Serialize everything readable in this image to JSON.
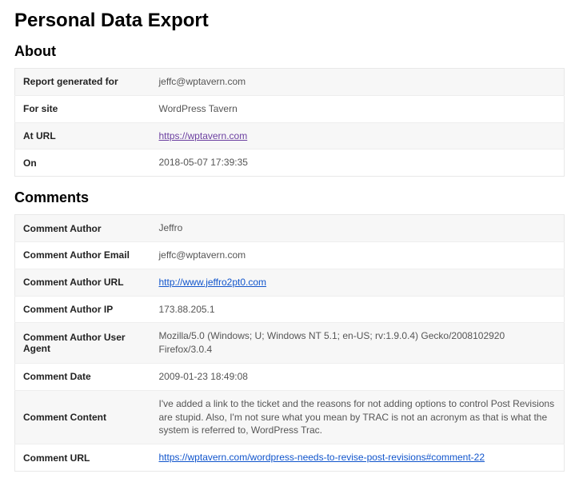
{
  "title": "Personal Data Export",
  "about": {
    "heading": "About",
    "rows": [
      {
        "label": "Report generated for",
        "value": "jeffc@wptavern.com",
        "type": "text"
      },
      {
        "label": "For site",
        "value": "WordPress Tavern",
        "type": "text"
      },
      {
        "label": "At URL",
        "value": "https://wptavern.com",
        "type": "link-visited"
      },
      {
        "label": "On",
        "value": "2018-05-07 17:39:35",
        "type": "text"
      }
    ]
  },
  "comments": {
    "heading": "Comments",
    "rows": [
      {
        "label": "Comment Author",
        "value": "Jeffro",
        "type": "text"
      },
      {
        "label": "Comment Author Email",
        "value": "jeffc@wptavern.com",
        "type": "text"
      },
      {
        "label": "Comment Author URL",
        "value": "http://www.jeffro2pt0.com",
        "type": "link"
      },
      {
        "label": "Comment Author IP",
        "value": "173.88.205.1",
        "type": "text"
      },
      {
        "label": "Comment Author User Agent",
        "value": "Mozilla/5.0 (Windows; U; Windows NT 5.1; en-US; rv:1.9.0.4) Gecko/2008102920 Firefox/3.0.4",
        "type": "text"
      },
      {
        "label": "Comment Date",
        "value": "2009-01-23 18:49:08",
        "type": "text"
      },
      {
        "label": "Comment Content",
        "value": "I've added a link to the ticket and the reasons for not adding options to control Post Revisions are stupid. Also, I'm not sure what you mean by TRAC is not an acronym as that is what the system is referred to, WordPress Trac.",
        "type": "text"
      },
      {
        "label": "Comment URL",
        "value": "https://wptavern.com/wordpress-needs-to-revise-post-revisions#comment-22",
        "type": "link"
      }
    ]
  }
}
